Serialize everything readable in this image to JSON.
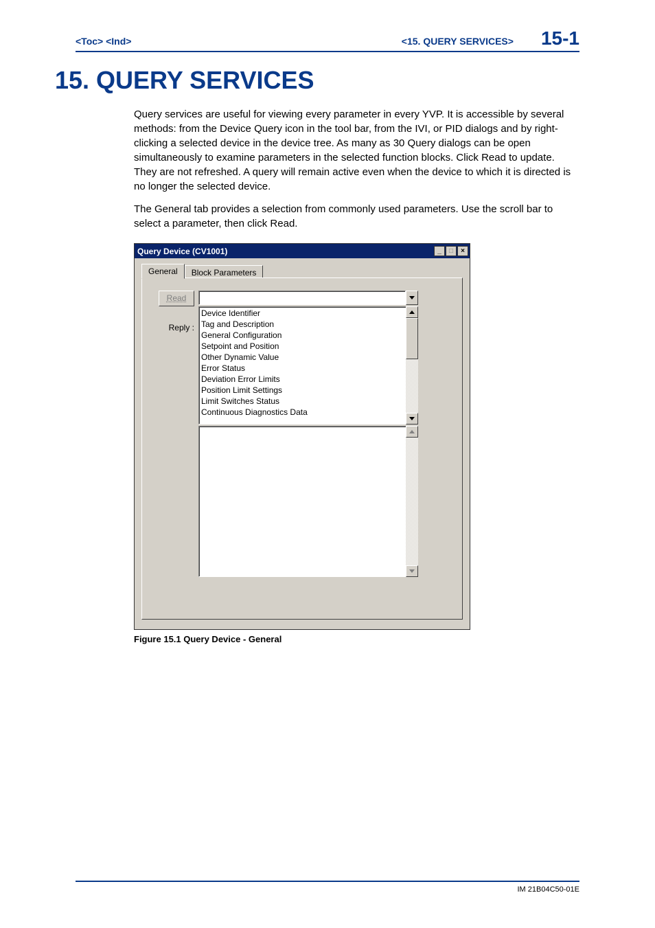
{
  "header": {
    "left_links": "<Toc> <Ind>",
    "section_link": "<15. QUERY SERVICES>",
    "page_number": "15-1"
  },
  "chapter_title": "15. QUERY SERVICES",
  "paragraphs": [
    "Query services are useful for viewing every parameter in every YVP. It is accessible by several methods: from the Device Query icon in the tool bar, from the IVI, or PID dialogs and by right-clicking a selected device in the device tree. As many as 30 Query dialogs can be open simultaneously to examine parameters in the selected function blocks. Click Read to update. They are not refreshed. A query will remain active even when the device to which it is directed is no longer the selected device.",
    "The General tab provides a selection from commonly used parameters. Use the scroll bar to select a parameter, then click Read."
  ],
  "dialog": {
    "title": "Query Device (CV1001)",
    "tabs": [
      "General",
      "Block Parameters"
    ],
    "read_label": "Read",
    "reply_label": "Reply :",
    "list_items": [
      "Device Identifier",
      "Tag and Description",
      "General Configuration",
      "Setpoint and Position",
      "Other Dynamic Value",
      "Error Status",
      "Deviation Error Limits",
      "Position Limit Settings",
      "Limit Switches Status",
      "Continuous Diagnostics Data"
    ]
  },
  "figure_caption": "Figure 15.1 Query Device - General",
  "footer": "IM 21B04C50-01E"
}
